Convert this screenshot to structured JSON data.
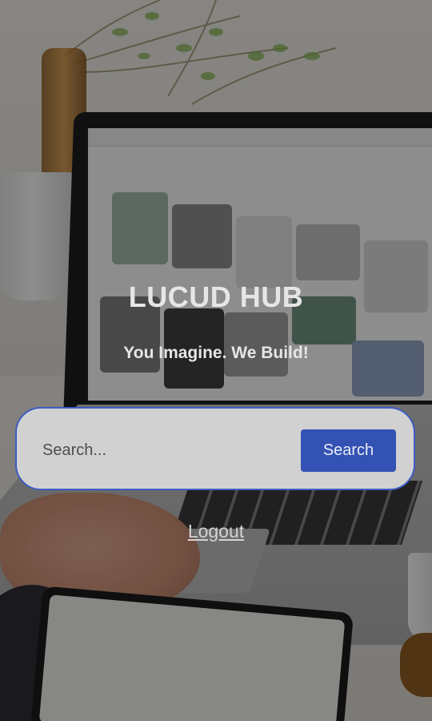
{
  "hero": {
    "title": "LUCUD HUB",
    "tagline": "You Imagine. We Build!"
  },
  "search": {
    "placeholder": "Search...",
    "value": "",
    "button_label": "Search"
  },
  "footer": {
    "logout_label": "Logout"
  },
  "colors": {
    "accent": "#3452b3",
    "search_border": "#3d5bc4",
    "search_background": "#d1d1d1",
    "hero_text": "#e6e6e6"
  },
  "background": {
    "icon": "workspace-photo-icon"
  }
}
